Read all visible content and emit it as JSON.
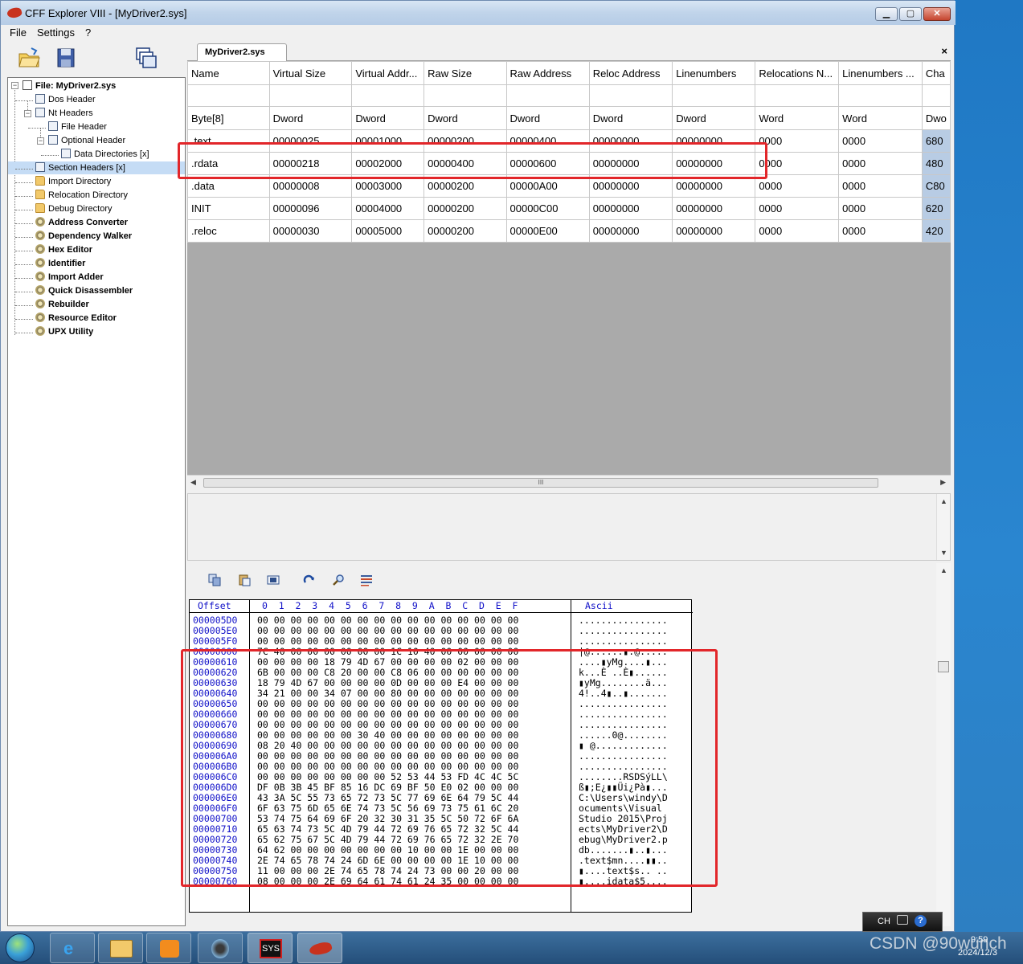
{
  "window": {
    "title": "CFF Explorer VIII - [MyDriver2.sys]",
    "min_label": "▁",
    "max_label": "▢",
    "close_label": "✕"
  },
  "menu": {
    "file": "File",
    "settings": "Settings",
    "help": "?"
  },
  "tree": {
    "root": "File: MyDriver2.sys",
    "items": [
      "Dos Header",
      "Nt Headers",
      "File Header",
      "Optional Header",
      "Data Directories [x]",
      "Section Headers [x]",
      "Import Directory",
      "Relocation Directory",
      "Debug Directory",
      "Address Converter",
      "Dependency Walker",
      "Hex Editor",
      "Identifier",
      "Import Adder",
      "Quick Disassembler",
      "Rebuilder",
      "Resource Editor",
      "UPX Utility"
    ]
  },
  "tab": {
    "label": "MyDriver2.sys",
    "close": "×"
  },
  "sections": {
    "headers": [
      "Name",
      "Virtual Size",
      "Virtual Addr...",
      "Raw Size",
      "Raw Address",
      "Reloc Address",
      "Linenumbers",
      "Relocations N...",
      "Linenumbers ...",
      "Cha"
    ],
    "types": [
      "Byte[8]",
      "Dword",
      "Dword",
      "Dword",
      "Dword",
      "Dword",
      "Dword",
      "Word",
      "Word",
      "Dwo"
    ],
    "rows": [
      [
        ".text",
        "00000025",
        "00001000",
        "00000200",
        "00000400",
        "00000000",
        "00000000",
        "0000",
        "0000",
        "680"
      ],
      [
        ".rdata",
        "00000218",
        "00002000",
        "00000400",
        "00000600",
        "00000000",
        "00000000",
        "0000",
        "0000",
        "480"
      ],
      [
        ".data",
        "00000008",
        "00003000",
        "00000200",
        "00000A00",
        "00000000",
        "00000000",
        "0000",
        "0000",
        "C80"
      ],
      [
        "INIT",
        "00000096",
        "00004000",
        "00000200",
        "00000C00",
        "00000000",
        "00000000",
        "0000",
        "0000",
        "620"
      ],
      [
        ".reloc",
        "00000030",
        "00005000",
        "00000200",
        "00000E00",
        "00000000",
        "00000000",
        "0000",
        "0000",
        "420"
      ]
    ]
  },
  "hscroll_grip": "III",
  "hex": {
    "head_offset": "Offset",
    "head_cols": "0  1  2  3  4  5  6  7  8  9  A  B  C  D  E  F",
    "head_ascii": "Ascii",
    "rows": [
      {
        "off": "000005D0",
        "bytes": "00 00 00 00 00 00 00 00 00 00 00 00 00 00 00 00",
        "ascii": "................"
      },
      {
        "off": "000005E0",
        "bytes": "00 00 00 00 00 00 00 00 00 00 00 00 00 00 00 00",
        "ascii": "................"
      },
      {
        "off": "000005F0",
        "bytes": "00 00 00 00 00 00 00 00 00 00 00 00 00 00 00 00",
        "ascii": "................"
      },
      {
        "off": "00000600",
        "bytes": "7C 40 00 00 00 00 00 00 1C 10 40 00 00 00 00 00",
        "ascii": "|@......▮.@....."
      },
      {
        "off": "00000610",
        "bytes": "00 00 00 00 18 79 4D 67 00 00 00 00 02 00 00 00",
        "ascii": "....▮yMg....▮..."
      },
      {
        "off": "00000620",
        "bytes": "6B 00 00 00 C8 20 00 00 C8 06 00 00 00 00 00 00",
        "ascii": "k...È ..È▮......"
      },
      {
        "off": "00000630",
        "bytes": "18 79 4D 67 00 00 00 00 0D 00 00 00 E4 00 00 00",
        "ascii": "▮yMg........ä..."
      },
      {
        "off": "00000640",
        "bytes": "34 21 00 00 34 07 00 00 80 00 00 00 00 00 00 00",
        "ascii": "4!..4▮..▮......."
      },
      {
        "off": "00000650",
        "bytes": "00 00 00 00 00 00 00 00 00 00 00 00 00 00 00 00",
        "ascii": "................"
      },
      {
        "off": "00000660",
        "bytes": "00 00 00 00 00 00 00 00 00 00 00 00 00 00 00 00",
        "ascii": "................"
      },
      {
        "off": "00000670",
        "bytes": "00 00 00 00 00 00 00 00 00 00 00 00 00 00 00 00",
        "ascii": "................"
      },
      {
        "off": "00000680",
        "bytes": "00 00 00 00 00 00 30 40 00 00 00 00 00 00 00 00",
        "ascii": "......0@........"
      },
      {
        "off": "00000690",
        "bytes": "08 20 40 00 00 00 00 00 00 00 00 00 00 00 00 00",
        "ascii": "▮ @............."
      },
      {
        "off": "000006A0",
        "bytes": "00 00 00 00 00 00 00 00 00 00 00 00 00 00 00 00",
        "ascii": "................"
      },
      {
        "off": "000006B0",
        "bytes": "00 00 00 00 00 00 00 00 00 00 00 00 00 00 00 00",
        "ascii": "................"
      },
      {
        "off": "000006C0",
        "bytes": "00 00 00 00 00 00 00 00 52 53 44 53 FD 4C 4C 5C",
        "ascii": "........RSDSýLL\\"
      },
      {
        "off": "000006D0",
        "bytes": "DF 0B 3B 45 BF 85 16 DC 69 BF 50 E0 02 00 00 00",
        "ascii": "ß▮;E¿▮▮Üi¿Pà▮..."
      },
      {
        "off": "000006E0",
        "bytes": "43 3A 5C 55 73 65 72 73 5C 77 69 6E 64 79 5C 44",
        "ascii": "C:\\Users\\windy\\D"
      },
      {
        "off": "000006F0",
        "bytes": "6F 63 75 6D 65 6E 74 73 5C 56 69 73 75 61 6C 20",
        "ascii": "ocuments\\Visual "
      },
      {
        "off": "00000700",
        "bytes": "53 74 75 64 69 6F 20 32 30 31 35 5C 50 72 6F 6A",
        "ascii": "Studio 2015\\Proj"
      },
      {
        "off": "00000710",
        "bytes": "65 63 74 73 5C 4D 79 44 72 69 76 65 72 32 5C 44",
        "ascii": "ects\\MyDriver2\\D"
      },
      {
        "off": "00000720",
        "bytes": "65 62 75 67 5C 4D 79 44 72 69 76 65 72 32 2E 70",
        "ascii": "ebug\\MyDriver2.p"
      },
      {
        "off": "00000730",
        "bytes": "64 62 00 00 00 00 00 00 00 10 00 00 1E 00 00 00",
        "ascii": "db.......▮..▮..."
      },
      {
        "off": "00000740",
        "bytes": "2E 74 65 78 74 24 6D 6E 00 00 00 00 1E 10 00 00",
        "ascii": ".text$mn....▮▮.."
      },
      {
        "off": "00000750",
        "bytes": "11 00 00 00 2E 74 65 78 74 24 73 00 00 20 00 00",
        "ascii": "▮....text$s.. .."
      },
      {
        "off": "00000760",
        "bytes": "08 00 00 00 2E 69 64 61 74 61 24 35 00 00 00 00",
        "ascii": "▮....idata$5...."
      }
    ]
  },
  "tray": {
    "lang": "CH",
    "time": "9:59",
    "date": "2024/12/3"
  },
  "watermark": "CSDN @90wunch",
  "taskbar_sys_label": "SYS",
  "colors": {
    "highlight_red": "#e2262a",
    "hex_offset_blue": "#1010c8",
    "selection": "#c5dcf5"
  }
}
